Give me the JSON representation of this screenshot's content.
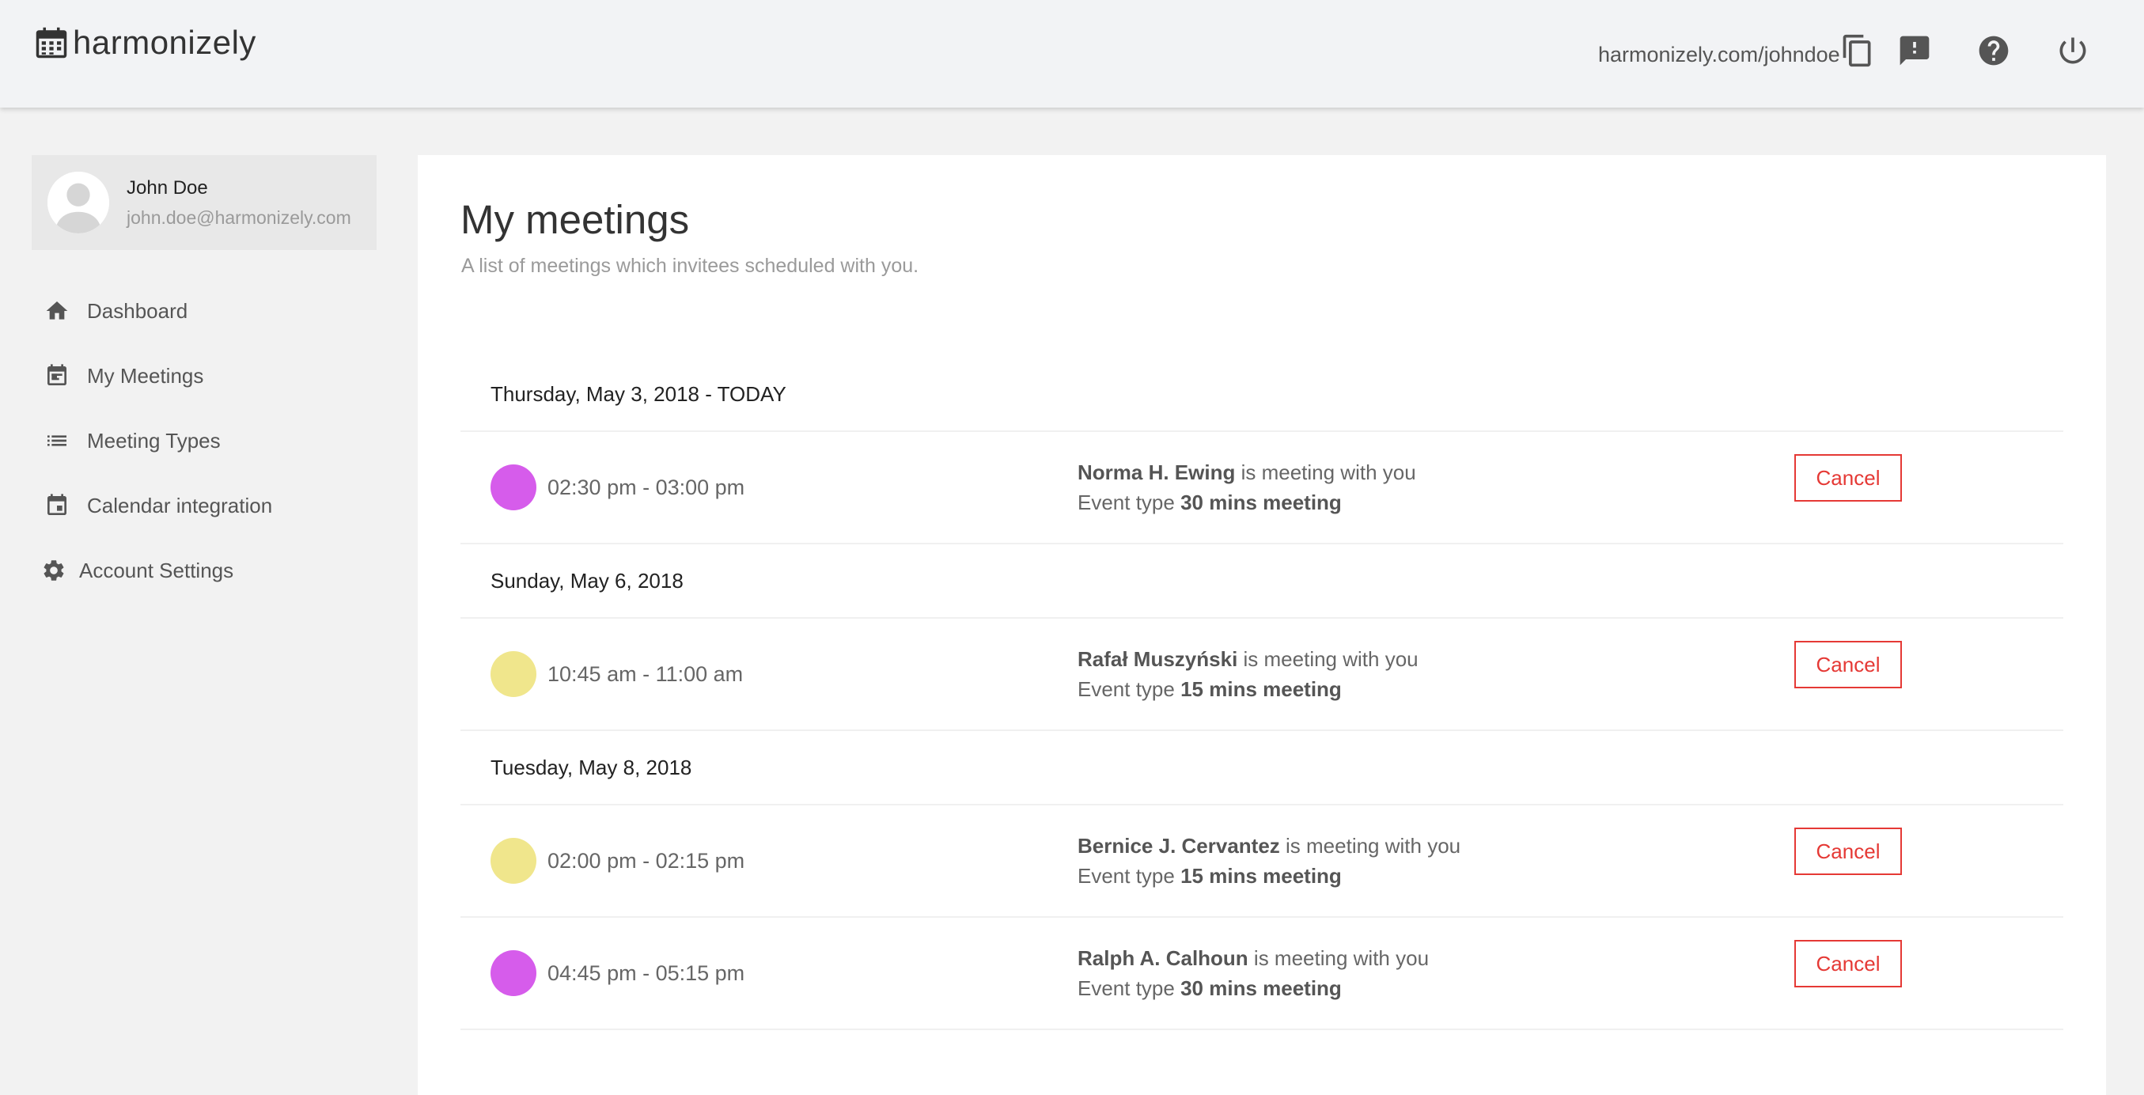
{
  "app": {
    "name": "harmonizely",
    "public_url": "harmonizely.com/johndoe"
  },
  "header": {
    "icons": [
      "calendar-icon",
      "copy-icon",
      "feedback-icon",
      "help-icon",
      "power-icon"
    ]
  },
  "user": {
    "name": "John Doe",
    "email": "john.doe@harmonizely.com"
  },
  "sidebar": {
    "items": [
      {
        "label": "Dashboard",
        "icon": "home-icon"
      },
      {
        "label": "My Meetings",
        "icon": "event-icon"
      },
      {
        "label": "Meeting Types",
        "icon": "list-icon"
      },
      {
        "label": "Calendar integration",
        "icon": "calendar-icon"
      },
      {
        "label": "Account Settings",
        "icon": "gear-icon"
      }
    ]
  },
  "main": {
    "title": "My meetings",
    "subtitle": "A list of meetings which invitees scheduled with you.",
    "groups": [
      {
        "date": "Thursday, May 3, 2018 - TODAY",
        "meetings": [
          {
            "color": "#d65ceb",
            "time": "02:30 pm - 03:00 pm",
            "name": "Norma H. Ewing",
            "meeting_text": " is meeting with you",
            "event_label": "Event type ",
            "event_type": "30 mins meeting",
            "action": "Cancel"
          }
        ]
      },
      {
        "date": "Sunday, May 6, 2018",
        "meetings": [
          {
            "color": "#f0e68c",
            "time": "10:45 am - 11:00 am",
            "name": "Rafał Muszyński",
            "meeting_text": " is meeting with you",
            "event_label": "Event type ",
            "event_type": "15 mins meeting",
            "action": "Cancel"
          }
        ]
      },
      {
        "date": "Tuesday, May 8, 2018",
        "meetings": [
          {
            "color": "#f0e68c",
            "time": "02:00 pm - 02:15 pm",
            "name": "Bernice J. Cervantez",
            "meeting_text": " is meeting with you",
            "event_label": "Event type ",
            "event_type": "15 mins meeting",
            "action": "Cancel"
          },
          {
            "color": "#d65ceb",
            "time": "04:45 pm - 05:15 pm",
            "name": "Ralph A. Calhoun",
            "meeting_text": " is meeting with you",
            "event_label": "Event type ",
            "event_type": "30 mins meeting",
            "action": "Cancel"
          }
        ]
      }
    ]
  },
  "colors": {
    "cancel": "#e53935",
    "text": "#333333",
    "muted": "#9a9a9a"
  }
}
